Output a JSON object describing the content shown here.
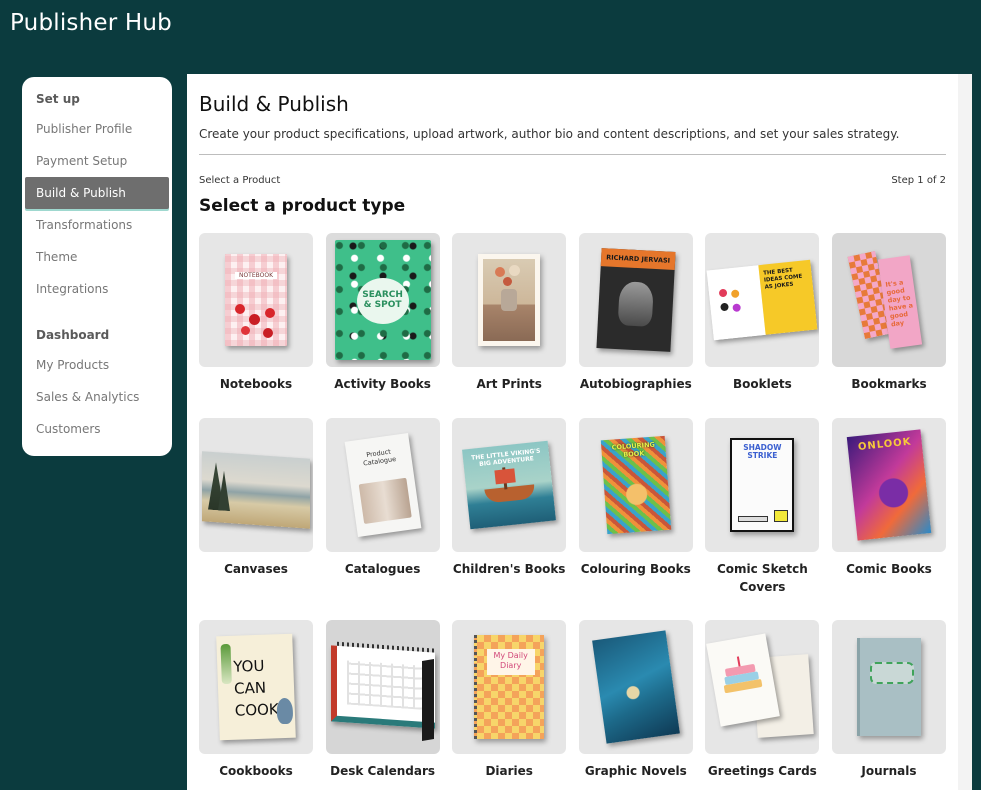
{
  "app": {
    "title": "Publisher Hub"
  },
  "sidebar": {
    "setup_heading": "Set up",
    "setup_items": [
      "Publisher Profile",
      "Payment Setup",
      "Build & Publish",
      "Transformations",
      "Theme",
      "Integrations"
    ],
    "active_item": "Build & Publish",
    "dashboard_heading": "Dashboard",
    "dashboard_items": [
      "My Products",
      "Sales & Analytics",
      "Customers"
    ]
  },
  "main": {
    "title": "Build & Publish",
    "description": "Create your product specifications, upload artwork, author bio and content descriptions, and set your sales strategy.",
    "breadcrumb": "Select a Product",
    "step": "Step 1 of 2",
    "section_title": "Select a product type"
  },
  "products": [
    {
      "label": "Notebooks",
      "cover_text": "NOTEBOOK"
    },
    {
      "label": "Activity Books",
      "cover_text": "SEARCH & SPOT"
    },
    {
      "label": "Art Prints",
      "cover_text": ""
    },
    {
      "label": "Autobiographies",
      "cover_text": "RICHARD JERVASI"
    },
    {
      "label": "Booklets",
      "cover_text": "THE BEST IDEAS COME AS JOKES"
    },
    {
      "label": "Bookmarks",
      "cover_text": "It's a good day to have a good day"
    },
    {
      "label": "Canvases",
      "cover_text": ""
    },
    {
      "label": "Catalogues",
      "cover_text": "Product Catalogue"
    },
    {
      "label": "Children's Books",
      "cover_text": "THE LITTLE VIKING'S BIG ADVENTURE"
    },
    {
      "label": "Colouring Books",
      "cover_text": "COLOURING BOOK"
    },
    {
      "label": "Comic Sketch Covers",
      "cover_text": "SHADOW STRIKE"
    },
    {
      "label": "Comic Books",
      "cover_text": "ONLOOK"
    },
    {
      "label": "Cookbooks",
      "cover_text": "YOU CAN COOK"
    },
    {
      "label": "Desk Calendars",
      "cover_text": ""
    },
    {
      "label": "Diaries",
      "cover_text": "My Daily Diary"
    },
    {
      "label": "Graphic Novels",
      "cover_text": ""
    },
    {
      "label": "Greetings Cards",
      "cover_text": ""
    },
    {
      "label": "Journals",
      "cover_text": ""
    }
  ]
}
